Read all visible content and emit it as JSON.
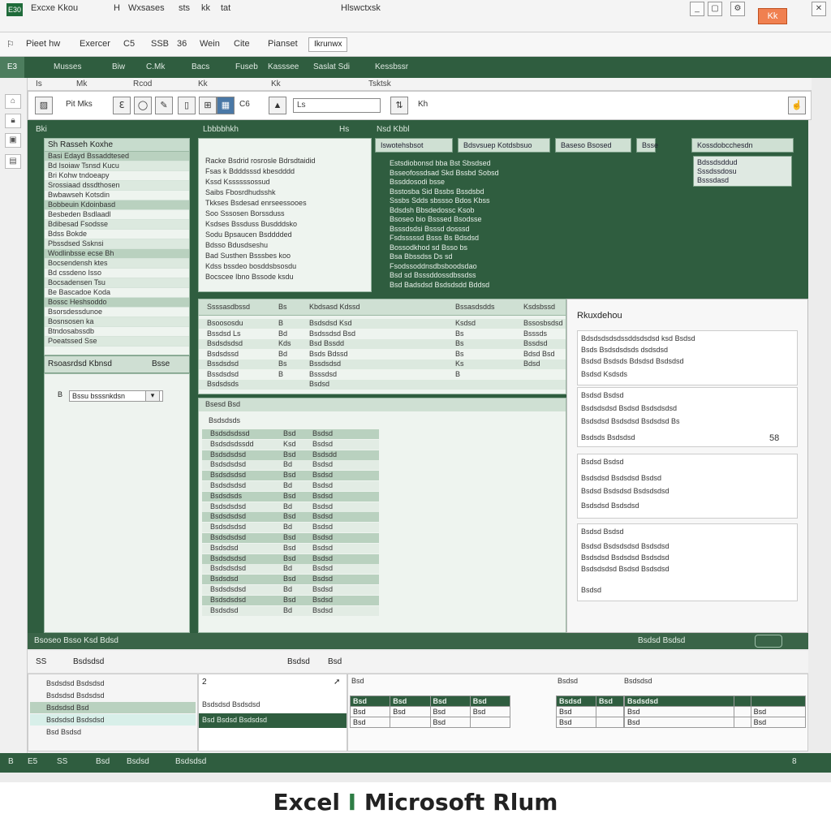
{
  "titlebar": {
    "app_badge": "E30",
    "items": [
      "Excxe Kkou",
      "H",
      "Wxsases",
      "sts",
      "kk",
      "tat"
    ],
    "center": "Hlswctxsk",
    "accent_label": "Kk"
  },
  "menubar": {
    "items": [
      "Pieet hw",
      "Exercer",
      "C5",
      "SSB",
      "36",
      "Wein",
      "Cite",
      "Pianset",
      "Ikrunwx"
    ]
  },
  "ribbon": {
    "selected": "E3",
    "tabs": [
      "Musses",
      "Biw",
      "C.Mk",
      "Bacs",
      "Fuseb",
      "Kasssee",
      "Saslat Sdi",
      "Kessbssr"
    ],
    "sub": [
      "Is",
      "Mk",
      "Rcod",
      "Kk",
      "Kk",
      "Tsktsk"
    ],
    "search_value": "Ls",
    "tool_labels": [
      "Pit Mks",
      "C6",
      "Kh"
    ]
  },
  "main": {
    "header": [
      "Bki",
      "Lbbbbhkh",
      "Hs",
      "Nsd Kbbl"
    ],
    "tree": {
      "title": "Sh Rasseh Koxhe",
      "rows": [
        "Basi Edayd Bssaddtesed",
        "Bd Isoiaw Tsnsd Kucu",
        "Bri Kohw tndoeapy",
        "Srossiaad dssdthosen",
        "Bwbawseh Kotsdin",
        "Bobbeuin Kdoinbasd",
        "Besbeden Bsdlaadl",
        "Bdibesad Fsodsse",
        "Bdss Bokde",
        "Pbssdsed Ssknsi",
        "Wodlinbsse ecse Bh",
        "Bocsendensh ktes",
        "Bd cssdeno Isso",
        "Bocsadensen Tsu",
        "Be Bascadoe Koda",
        "Bossc Heshsoddo",
        "Bsorsdessdunoe",
        "Bosnsosen ka",
        "Btndosabssdb",
        "Poeatssed Sse"
      ],
      "foot_left": "Rsoasrdsd Kbnsd",
      "foot_right": "Bsse",
      "lower_label": "Bssu bsssnkdsn",
      "lower_num": "B"
    },
    "text_pane": {
      "lines": [
        "Racke Bsdrid rosrosle Bdrsdtaidid",
        "Fsas k Bdddsssd kbesdddd",
        "Kssd Kssssssossud",
        "Saibs Fbosrdhudsshk",
        "Tkkses Bsdesad enrseessooes",
        "Soo Sssosen Borssduss",
        "Ksdses Bssduss Busdddsko",
        "Sodu Bpsaucen Bsdddded",
        "Bdsso Bdusdseshu",
        "Bad Susthen Bsssbes koo",
        "Kdss bssdeo bosddsbsosdu",
        "Bocscee Ibno Bssode ksdu"
      ]
    },
    "green_info": {
      "tabs": [
        "Iswotehsbsot",
        "Bdsvsuep Kotdsbsuo",
        "Baseso Bsosed",
        "Bsse",
        "Kossdobcchesdn"
      ],
      "lines": [
        "Estsdiobonsd bba Bst Sbsdsed",
        "Bsseofossdsad Skd Bssbd Sobsd",
        "Bssddosodi bsse",
        "Bsstosba Sid Bssbs Bssdsbd",
        "Sssbs Sdds sbssso Bdos Kbss",
        "Bdsdsh Bbsdedossc Ksob",
        "Bsoseo bio Bsssed Bsodsse",
        "Bsssdsdsi Bsssd dosssd",
        "Fsdsssssd Bsss Bs Bdsdsd",
        "Bossodkhod sd Bsso bs",
        "Bsa Bbssdss Ds sd",
        "Fsodssoddnsdbsboodsdao",
        "Bsd sd Bsssddossdbssdss",
        "Bsd Badsdsd Bsdsdsdd Bddsd"
      ],
      "right_lines": [
        "Bdssdsddud",
        "Sssdssdosu",
        "Bsssdasd"
      ]
    },
    "grid_a": {
      "headers": [
        "Ssssasdbssd",
        "Bs",
        "Kbdsasd Kdssd",
        "Bssasdsdds",
        "Ksdsbssd"
      ],
      "rows": [
        [
          "Bsoososdu",
          "B",
          "Bsdsdsd Ksd",
          "Ksdsd",
          "Bssosbsdsd"
        ],
        [
          "Bssdsd Ls",
          "Bd",
          "Bsdssdsd Bsd",
          "Bs",
          "Bsssds"
        ],
        [
          "Bsdsdsdsd",
          "Kds",
          "Bsd Bssdd",
          "Bs",
          "Bssdsd"
        ],
        [
          "Bsdsdssd",
          "Bd",
          "Bsds Bdssd",
          "Bs",
          "Bdsd Bsd"
        ],
        [
          "Bssdsdsd",
          "Bs",
          "Bssdsdsd",
          "Ks",
          "Bdsd"
        ],
        [
          "Bssdsdsd",
          "B",
          "Bsssdsd",
          "B",
          ""
        ],
        [
          "Bsdsdsds",
          "",
          "Bsdsd",
          "",
          ""
        ]
      ]
    },
    "grid_b": {
      "header": "Bsesd Bsd",
      "title": "Bsdsdsds",
      "rows": [
        [
          "Bsdsdsdssd",
          "Bsd",
          "Bsdsd"
        ],
        [
          "Bsdsdsdssdd",
          "Ksd",
          "Bsdsd"
        ],
        [
          "Bsdsdsdsd",
          "Bsd",
          "Bsdsdd"
        ],
        [
          "Bsdsdsdsd",
          "Bd",
          "Bsdsd"
        ],
        [
          "Bsdsdsdsd",
          "Bsd",
          "Bsdsd"
        ],
        [
          "Bsdsdsdsd",
          "Bd",
          "Bsdsd"
        ],
        [
          "Bsdsdsds",
          "Bsd",
          "Bsdsd"
        ],
        [
          "Bsdsdsdsd",
          "Bd",
          "Bsdsd"
        ],
        [
          "Bsdsdsdsd",
          "Bsd",
          "Bsdsd"
        ],
        [
          "Bsdsdsdsd",
          "Bd",
          "Bsdsd"
        ],
        [
          "Bsdsdsdsd",
          "Bsd",
          "Bsdsd"
        ],
        [
          "Bsdsdsd",
          "Bsd",
          "Bsdsd"
        ],
        [
          "Bsdsdsdsd",
          "Bsd",
          "Bsdsd"
        ],
        [
          "Bsdsdsdsd",
          "Bd",
          "Bsdsd"
        ],
        [
          "Bsdsdsd",
          "Bsd",
          "Bsdsd"
        ],
        [
          "Bsdsdsdsd",
          "Bd",
          "Bsdsd"
        ],
        [
          "Bsdsdsdsd",
          "Bsd",
          "Bsdsd"
        ],
        [
          "Bsdsdsd",
          "Bd",
          "Bsdsd"
        ]
      ]
    },
    "right_pane": {
      "title": "Rkuxdehou",
      "box1": [
        "Bdsdsdsdsdssddsdsdsd ksd Bsdsd",
        "Bsds Bsdsdsdsds dsdsdsd",
        "Bsdsd Bsdsds Bdsdsd Bsdsdsd",
        "Bsdsd Ksdsds"
      ],
      "box2_title": "Bsdsd Bsdsd",
      "box2": [
        "Bsdsdsdsd Bsdsd Bsdsdsdsd",
        "Bsdsdsd Bsdsdsd Bsdsdsd Bs",
        "Bsdsds Bsdsdsd"
      ],
      "box2_val": "58",
      "box3_title": "Bsdsd Bsdsd",
      "box3": [
        "Bsdsdsd Bsdsdsd Bsdsd",
        "Bsdsd Bsdsdsd Bsdsdsdsd",
        "Bsdsdsd Bsdsdsd"
      ],
      "box4_title": "Bsdsd Bsdsd",
      "box4": [
        "Bsdsd Bsdsdsdsd Bsdsdsd",
        "Bsdsdsd Bsdsdsd Bsdsdsd",
        "Bsdsdsdsd Bsdsd Bsdsdsd"
      ],
      "box4_foot": "Bsdsd"
    },
    "status": {
      "left": "Bsoseo Bsso Ksd Bdsd",
      "right": "Bsdsd Bsdsd"
    }
  },
  "bottom": {
    "head": [
      "SS",
      "Bsdsdsd",
      "Bsdsd",
      "Bsd"
    ],
    "left_rows": [
      "Bsdsdsd Bsdsdsd",
      "Bsdsdsd Bsdsdsd",
      "Bsdsdsd Bsd",
      "Bsdsdsd Bsdsdsd",
      "Bsd Bsdsd"
    ],
    "mid_num": "2",
    "mid_rows": [
      "Bsdsdsd Bsdsdsd",
      "Bsd Bsdsd Bsdsdsd"
    ],
    "right_head": [
      "Bsd",
      "Bsdsd",
      "Bsdsdsd"
    ],
    "grid1_cols": [
      "Bsd",
      "Bsd",
      "Bsd",
      "Bsd"
    ],
    "grid1_rows": [
      [
        "Bsd",
        "Bsd",
        "Bsd",
        "Bsd"
      ],
      [
        "Bsd",
        "",
        "Bsd",
        ""
      ]
    ],
    "grid2_cols": [
      "Bsdsd",
      "Bsd"
    ],
    "grid2_rows": [
      [
        "Bsd",
        ""
      ],
      [
        "Bsd",
        ""
      ]
    ],
    "grid3_cols": [
      "Bsdsdsd",
      "",
      ""
    ],
    "grid3_rows": [
      [
        "Bsd",
        "",
        "Bsd"
      ],
      [
        "Bsd",
        "",
        "Bsd"
      ]
    ]
  },
  "statusbar": {
    "items": [
      "B",
      "E5",
      "SS",
      "Bsd",
      "Bsdsd",
      "Bsdsdsd"
    ],
    "right": "8"
  },
  "caption": {
    "prefix": "Excel",
    "mark": "I",
    "suffix": "Microsoft Rlum"
  },
  "colors": {
    "brand_green": "#2f5d3f",
    "accent_orange": "#f08050"
  }
}
